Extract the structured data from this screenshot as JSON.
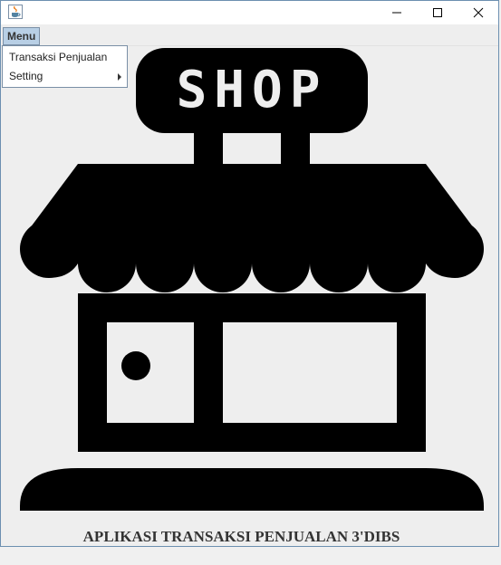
{
  "window": {
    "title": "",
    "icon": "java-cup-icon",
    "controls": [
      "minimize-icon",
      "maximize-icon",
      "close-icon"
    ]
  },
  "menubar": {
    "menu_label": "Menu"
  },
  "menu_popup": {
    "items": [
      {
        "label": "Transaksi Penjualan",
        "has_submenu": false
      },
      {
        "label": "Setting",
        "has_submenu": true
      }
    ]
  },
  "content": {
    "sign_text": "SHOP",
    "footer": "APLIKASI TRANSAKSI PENJUALAN 3'DIBS",
    "illustration": "shop-icon"
  }
}
